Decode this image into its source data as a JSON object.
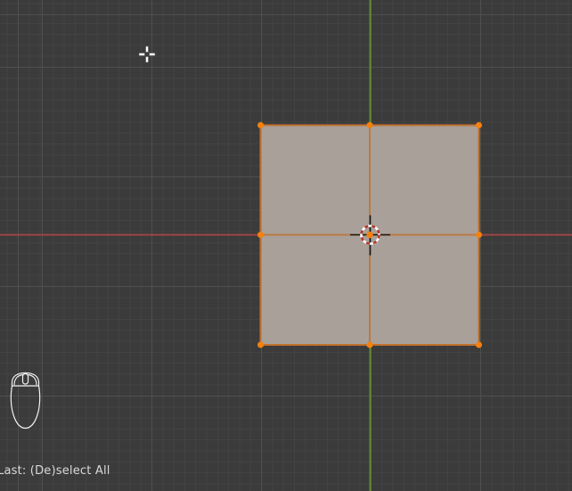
{
  "viewport": {
    "app_context": "3d-viewport-edit-mode",
    "status_text": "Last: (De)select All",
    "mesh": {
      "type": "plane",
      "subdivisions": "2x2",
      "vertices_visible": 9,
      "all_selected": true
    },
    "icons": [
      "axis-x-line",
      "axis-y-line",
      "3d-cursor",
      "mouse-pointer-crosshair-icon",
      "mouse-hint-icon"
    ],
    "colors": {
      "background": "#3b3b3b",
      "grid_fine": "#434343",
      "grid_major": "#4f4f4f",
      "axis_x": "#9d4646",
      "axis_y": "#628e2f",
      "face_fill": "#a9a09a",
      "edge_outer": "#c0702c",
      "edge_inner": "#bb7a40",
      "vertex": "#f5810c",
      "cursor_red": "#b5372b",
      "cursor_white": "#ffffff",
      "cursor_cross": "#161616",
      "pointer_white": "#ffffff",
      "pointer_outline": "#555555",
      "mouse_outline": "#f2f2f2",
      "status_text": "#d9d9d9"
    }
  }
}
